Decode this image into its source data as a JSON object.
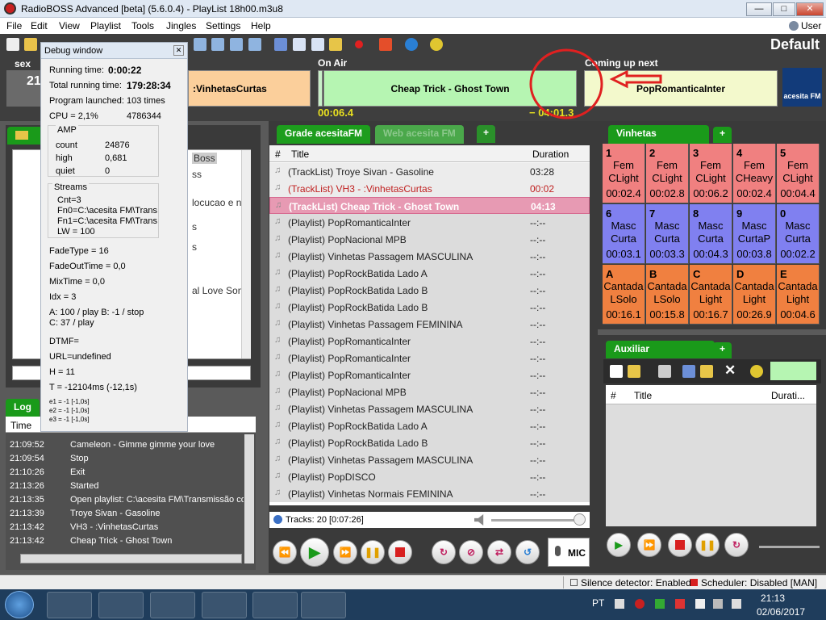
{
  "window": {
    "title": "RadioBOSS Advanced [beta] (5.6.0.4) - PlayList 18h00.m3u8",
    "min": "—",
    "max": "□",
    "close": "✕"
  },
  "menu": [
    "File",
    "Edit",
    "View",
    "Playlist",
    "Tools",
    "Jingles",
    "Settings",
    "Help"
  ],
  "user": "User",
  "profile": "Default",
  "clock": {
    "day": "sex",
    "time": "21"
  },
  "previous": {
    "title": ":VinhetasCurtas"
  },
  "on_air": {
    "label": "On Air",
    "title": "Cheap Trick - Ghost Town",
    "elapsed": "00:06.4",
    "remaining": "− 04:01.3"
  },
  "coming_up": {
    "label": "Coming up next",
    "title": "PopRomanticaInter"
  },
  "logo_text": "acesita FM",
  "left_panel": {
    "items": [
      "Boss",
      "ss",
      "locucao e ne",
      "s",
      "s",
      "al Love Song"
    ]
  },
  "playlist": {
    "tabs": [
      "Grade acesitaFM",
      "Web acesita FM",
      "+"
    ],
    "columns": {
      "num": "#",
      "title": "Title",
      "duration": "Duration"
    },
    "rows": [
      {
        "title": "(TrackList) Troye Sivan - Gasoline",
        "duration": "03:28",
        "state": "played"
      },
      {
        "title": "(TrackList) VH3 - :VinhetasCurtas",
        "duration": "00:02",
        "state": "previous"
      },
      {
        "title": "(TrackList) Cheap Trick - Ghost Town",
        "duration": "04:13",
        "state": "playing"
      },
      {
        "title": "(Playlist) PopRomanticaInter",
        "duration": "--:--",
        "state": "queued"
      },
      {
        "title": "(Playlist) PopNacional MPB",
        "duration": "--:--",
        "state": "queued"
      },
      {
        "title": "(Playlist) Vinhetas Passagem MASCULINA",
        "duration": "--:--",
        "state": "queued"
      },
      {
        "title": "(Playlist) PopRockBatida Lado A",
        "duration": "--:--",
        "state": "queued"
      },
      {
        "title": "(Playlist) PopRockBatida Lado B",
        "duration": "--:--",
        "state": "queued"
      },
      {
        "title": "(Playlist) PopRockBatida Lado B",
        "duration": "--:--",
        "state": "queued"
      },
      {
        "title": "(Playlist) Vinhetas Passagem FEMININA",
        "duration": "--:--",
        "state": "queued"
      },
      {
        "title": "(Playlist) PopRomanticaInter",
        "duration": "--:--",
        "state": "queued"
      },
      {
        "title": "(Playlist) PopRomanticaInter",
        "duration": "--:--",
        "state": "queued"
      },
      {
        "title": "(Playlist) PopRomanticaInter",
        "duration": "--:--",
        "state": "queued"
      },
      {
        "title": "(Playlist) PopNacional MPB",
        "duration": "--:--",
        "state": "queued"
      },
      {
        "title": "(Playlist) Vinhetas Passagem MASCULINA",
        "duration": "--:--",
        "state": "queued"
      },
      {
        "title": "(Playlist) PopRockBatida Lado A",
        "duration": "--:--",
        "state": "queued"
      },
      {
        "title": "(Playlist) PopRockBatida Lado B",
        "duration": "--:--",
        "state": "queued"
      },
      {
        "title": "(Playlist) Vinhetas Passagem MASCULINA",
        "duration": "--:--",
        "state": "queued"
      },
      {
        "title": "(Playlist) PopDISCO",
        "duration": "--:--",
        "state": "queued"
      },
      {
        "title": "(Playlist) Vinhetas Normais FEMININA",
        "duration": "--:--",
        "state": "queued"
      }
    ],
    "footer": "Tracks: 20 [0:07:26]"
  },
  "mic_label": "MIC",
  "vinhetas": {
    "tab": "Vinhetas",
    "carts": [
      {
        "key": "1",
        "l1": "Fem",
        "l2": "CLight",
        "time": "00:02.4",
        "color": "#f08080"
      },
      {
        "key": "2",
        "l1": "Fem",
        "l2": "CLight",
        "time": "00:02.8",
        "color": "#f08080"
      },
      {
        "key": "3",
        "l1": "Fem",
        "l2": "CLight",
        "time": "00:06.2",
        "color": "#f08080"
      },
      {
        "key": "4",
        "l1": "Fem",
        "l2": "CHeavy",
        "time": "00:02.4",
        "color": "#f08080"
      },
      {
        "key": "5",
        "l1": "Fem",
        "l2": "CLight",
        "time": "00:04.4",
        "color": "#f08080"
      },
      {
        "key": "6",
        "l1": "Masc",
        "l2": "Curta",
        "time": "00:03.1",
        "color": "#8080f0"
      },
      {
        "key": "7",
        "l1": "Masc",
        "l2": "Curta",
        "time": "00:03.3",
        "color": "#8080f0"
      },
      {
        "key": "8",
        "l1": "Masc",
        "l2": "Curta",
        "time": "00:04.3",
        "color": "#8080f0"
      },
      {
        "key": "9",
        "l1": "Masc",
        "l2": "CurtaP",
        "time": "00:03.8",
        "color": "#8080f0"
      },
      {
        "key": "0",
        "l1": "Masc",
        "l2": "Curta",
        "time": "00:02.2",
        "color": "#8080f0"
      },
      {
        "key": "A",
        "l1": "Cantada",
        "l2": "LSolo",
        "time": "00:16.1",
        "color": "#f08040"
      },
      {
        "key": "B",
        "l1": "Cantada",
        "l2": "LSolo",
        "time": "00:15.8",
        "color": "#f08040"
      },
      {
        "key": "C",
        "l1": "Cantada",
        "l2": "Light",
        "time": "00:16.7",
        "color": "#f08040"
      },
      {
        "key": "D",
        "l1": "Cantada",
        "l2": "Light",
        "time": "00:26.9",
        "color": "#f08040"
      },
      {
        "key": "E",
        "l1": "Cantada",
        "l2": "Light",
        "time": "00:04.6",
        "color": "#f08040"
      }
    ]
  },
  "auxiliar": {
    "tab": "Auxiliar",
    "columns": {
      "num": "#",
      "title": "Title",
      "duration": "Durati..."
    }
  },
  "debug": {
    "title": "Debug window",
    "running_time_label": "Running time:",
    "running_time": "0:00:22",
    "total_label": "Total running time:",
    "total": "179:28:34",
    "launched": "Program launched:   103 times",
    "cpu": "CPU = 2,1%",
    "mem": "4786344",
    "amp": {
      "label": "AMP",
      "count_l": "count",
      "count": "24876",
      "high_l": "high",
      "high": "0,681",
      "quiet_l": "quiet",
      "quiet": "0"
    },
    "streams": {
      "label": "Streams",
      "lines": [
        "Cnt=3",
        "Fn0=C:\\acesita FM\\Trans",
        "Fn1=C:\\acesita FM\\Trans",
        "LW = 100"
      ]
    },
    "lines": [
      "FadeType = 16",
      "FadeOutTime = 0,0",
      "MixTime = 0,0",
      "Idx = 3",
      "A: 100 / play  B: -1 / stop",
      "C: 37 / play",
      "DTMF=",
      "URL=undefined",
      "H = 11",
      "T = -12104ms (-12,1s)"
    ],
    "e_lines": [
      "e1 = -1 [-1,0s]",
      "e2 = -1 [-1,0s]",
      "e3 = -1 [-1,0s]"
    ]
  },
  "log": {
    "tab": "Log",
    "time_col": "Time",
    "rows": [
      {
        "time": "21:09:52",
        "text": "Cameleon - Gimme gimme your love"
      },
      {
        "time": "21:09:54",
        "text": "Stop"
      },
      {
        "time": "21:10:26",
        "text": "Exit"
      },
      {
        "time": "21:13:26",
        "text": "Started"
      },
      {
        "time": "21:13:35",
        "text": "Open playlist: C:\\acesita FM\\Transmissão co"
      },
      {
        "time": "21:13:39",
        "text": "Troye Sivan - Gasoline"
      },
      {
        "time": "21:13:42",
        "text": "VH3 - :VinhetasCurtas"
      },
      {
        "time": "21:13:42",
        "text": "Cheap Trick - Ghost Town"
      }
    ]
  },
  "status": {
    "silence": "Silence detector: Enabled",
    "scheduler": "Scheduler: Disabled [MAN]"
  },
  "taskbar": {
    "lang": "PT",
    "time": "21:13",
    "date": "02/06/2017"
  }
}
